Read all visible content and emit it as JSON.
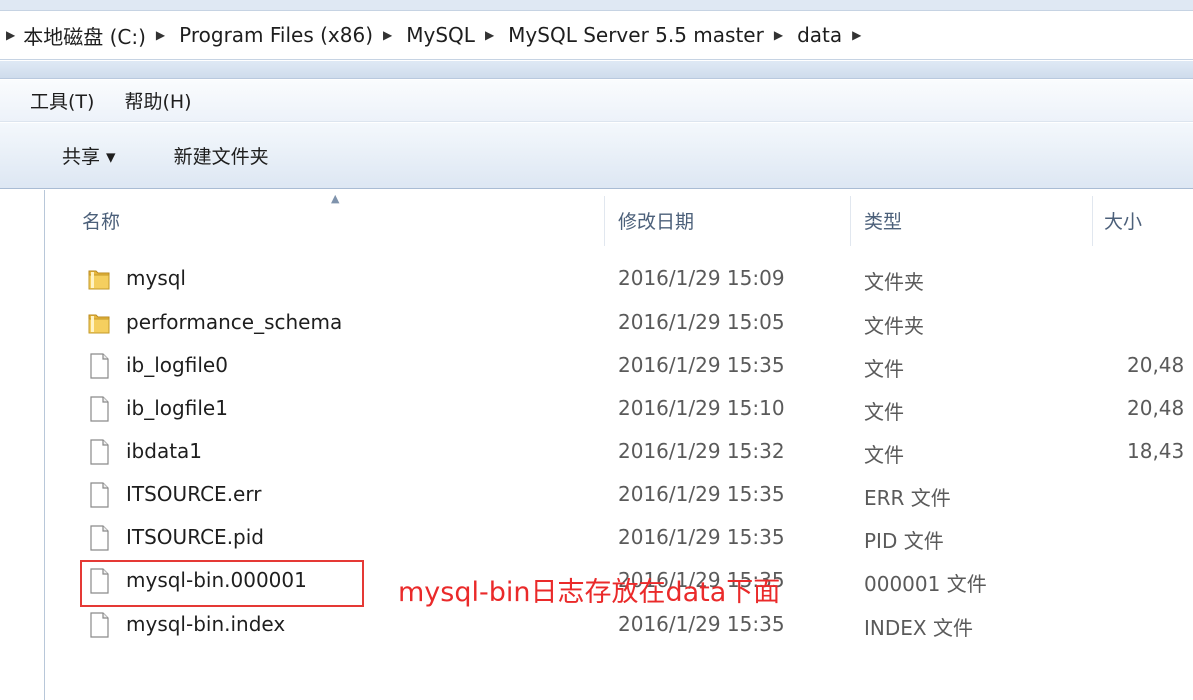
{
  "breadcrumb": {
    "items": [
      "本地磁盘 (C:)",
      "Program Files (x86)",
      "MySQL",
      "MySQL Server 5.5 master",
      "data"
    ]
  },
  "menu": {
    "tools": "工具(T)",
    "help": "帮助(H)"
  },
  "toolbar": {
    "share": "共享 ▾",
    "new_folder": "新建文件夹"
  },
  "columns": {
    "name": "名称",
    "modified": "修改日期",
    "type": "类型",
    "size": "大小"
  },
  "files": [
    {
      "name": "mysql",
      "date": "2016/1/29 15:09",
      "type": "文件夹",
      "size": "",
      "icon": "folder-icon"
    },
    {
      "name": "performance_schema",
      "date": "2016/1/29 15:05",
      "type": "文件夹",
      "size": "",
      "icon": "folder-icon"
    },
    {
      "name": "ib_logfile0",
      "date": "2016/1/29 15:35",
      "type": "文件",
      "size": "20,48",
      "icon": "file-icon"
    },
    {
      "name": "ib_logfile1",
      "date": "2016/1/29 15:10",
      "type": "文件",
      "size": "20,48",
      "icon": "file-icon"
    },
    {
      "name": "ibdata1",
      "date": "2016/1/29 15:32",
      "type": "文件",
      "size": "18,43",
      "icon": "file-icon"
    },
    {
      "name": "ITSOURCE.err",
      "date": "2016/1/29 15:35",
      "type": "ERR 文件",
      "size": "",
      "icon": "file-icon"
    },
    {
      "name": "ITSOURCE.pid",
      "date": "2016/1/29 15:35",
      "type": "PID 文件",
      "size": "",
      "icon": "file-icon"
    },
    {
      "name": "mysql-bin.000001",
      "date": "2016/1/29 15:35",
      "type": "000001 文件",
      "size": "",
      "icon": "file-icon"
    },
    {
      "name": "mysql-bin.index",
      "date": "2016/1/29 15:35",
      "type": "INDEX 文件",
      "size": "",
      "icon": "file-icon"
    }
  ],
  "annotation": {
    "text": "mysql-bin日志存放在data下面",
    "color": "#ea2a2a"
  }
}
